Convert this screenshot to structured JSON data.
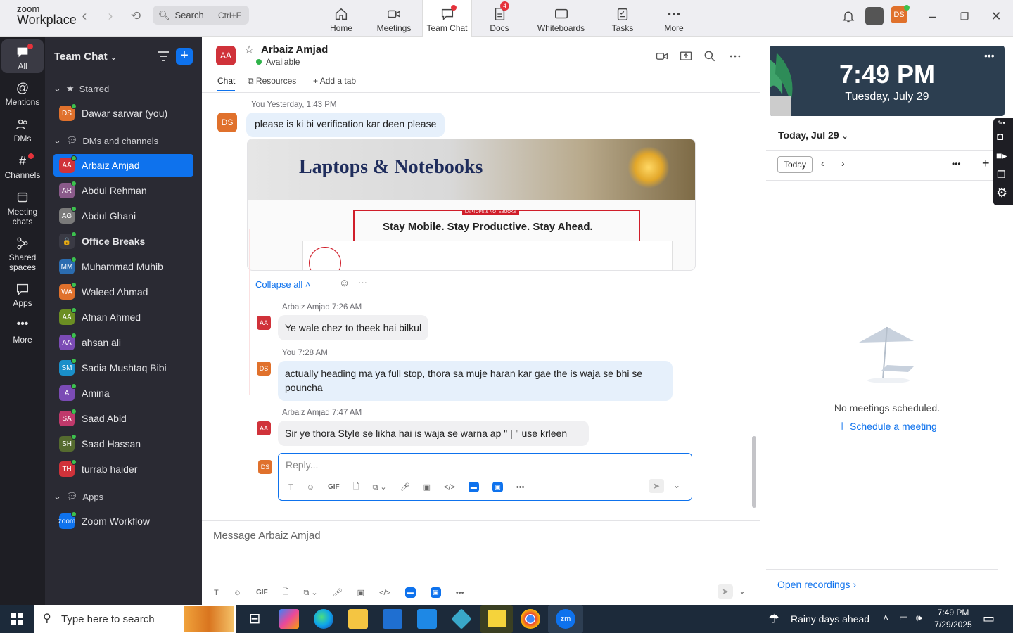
{
  "app": {
    "logo_top": "zoom",
    "logo_bottom": "Workplace"
  },
  "search": {
    "label": "Search",
    "shortcut": "Ctrl+F"
  },
  "tabs": [
    {
      "label": "Home"
    },
    {
      "label": "Meetings"
    },
    {
      "label": "Team Chat"
    },
    {
      "label": "Docs",
      "badge": "4"
    },
    {
      "label": "Whiteboards"
    },
    {
      "label": "Tasks"
    },
    {
      "label": "More"
    }
  ],
  "user_initials": "DS",
  "rail": [
    {
      "label": "All"
    },
    {
      "label": "Mentions"
    },
    {
      "label": "DMs"
    },
    {
      "label": "Channels"
    },
    {
      "label": "Meeting chats"
    },
    {
      "label": "Shared spaces"
    },
    {
      "label": "Apps"
    },
    {
      "label": "More"
    }
  ],
  "sidebar": {
    "title": "Team Chat",
    "starred_label": "Starred",
    "starred": [
      {
        "initials": "DS",
        "name": "Dawar sarwar (you)",
        "color": "#e0712c"
      }
    ],
    "dms_label": "DMs and channels",
    "items": [
      {
        "initials": "AA",
        "name": "Arbaiz Amjad",
        "color": "#d0323a",
        "selected": true
      },
      {
        "initials": "AR",
        "name": "Abdul Rehman",
        "color": "#8a5a8a"
      },
      {
        "initials": "AG",
        "name": "Abdul Ghani",
        "color": "#7a7a7a"
      },
      {
        "initials": "🔒",
        "name": "Office Breaks",
        "color": "#3a3a44",
        "bold": true
      },
      {
        "initials": "MM",
        "name": "Muhammad Muhib",
        "color": "#2b6cb0"
      },
      {
        "initials": "WA",
        "name": "Waleed Ahmad",
        "color": "#e0712c"
      },
      {
        "initials": "AA",
        "name": "Afnan Ahmed",
        "color": "#6b8e23"
      },
      {
        "initials": "AA",
        "name": "ahsan ali",
        "color": "#7b4bb5"
      },
      {
        "initials": "SM",
        "name": "Sadia Mushtaq Bibi",
        "color": "#1a8fc9"
      },
      {
        "initials": "A",
        "name": "Amina",
        "color": "#7b4bb5"
      },
      {
        "initials": "SA",
        "name": "Saad Abid",
        "color": "#c0396b"
      },
      {
        "initials": "SH",
        "name": "Saad Hassan",
        "color": "#556b2f"
      },
      {
        "initials": "TH",
        "name": "turrab haider",
        "color": "#d0323a"
      }
    ],
    "apps_label": "Apps",
    "apps": [
      {
        "initials": "zoom",
        "name": "Zoom Workflow",
        "color": "#0e72ed"
      }
    ]
  },
  "chat": {
    "name": "Arbaiz Amjad",
    "initials": "AA",
    "status": "Available",
    "tabs": {
      "chat": "Chat",
      "resources": "Resources",
      "add": "Add a tab"
    },
    "messages": [
      {
        "sender": "You",
        "time": "Yesterday, 1:43 PM",
        "text": "please is ki bi verification kar deen please",
        "initials": "DS"
      },
      {
        "sender": "Arbaiz Amjad",
        "time": "7:26 AM",
        "text": "Ye wale chez to theek hai bilkul",
        "initials": "AA"
      },
      {
        "sender": "You",
        "time": "7:28 AM",
        "text": "actually heading ma ya full stop, thora sa muje haran kar gae the is waja se bhi se pouncha",
        "initials": "DS"
      },
      {
        "sender": "Arbaiz Amjad",
        "time": "7:47 AM",
        "text": "Sir ye thora Style se likha hai is waja se warna ap \" | \" use krleen",
        "initials": "AA"
      }
    ],
    "image": {
      "banner": "Laptops & Notebooks",
      "tag": "LAPTOPS & NOTEBOOKS",
      "tagline": "Stay Mobile. Stay Productive. Stay Ahead."
    },
    "collapse": "Collapse all",
    "reply_placeholder": "Reply...",
    "composer_placeholder": "Message Arbaiz Amjad",
    "toolbar": {
      "gif": "GIF"
    }
  },
  "calendar": {
    "time": "7:49 PM",
    "date": "Tuesday, July 29",
    "day_header": "Today, Jul 29",
    "today_btn": "Today",
    "empty": "No meetings scheduled.",
    "schedule": "Schedule a meeting",
    "recordings": "Open recordings"
  },
  "taskbar": {
    "search": "Type here to search",
    "weather": "Rainy days ahead",
    "time": "7:49 PM",
    "date": "7/29/2025"
  }
}
